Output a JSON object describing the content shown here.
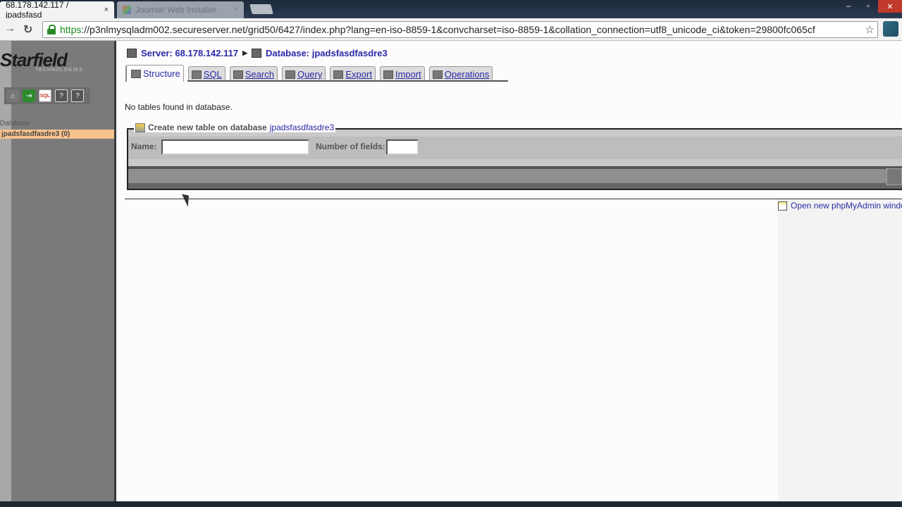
{
  "browser": {
    "tabs": [
      {
        "title": "68.178.142.117 / jpadsfasd",
        "active": true
      },
      {
        "title": "Joomla! Web Installer",
        "active": false
      }
    ],
    "url_scheme": "https",
    "url_rest": "://p3nlmysqladm002.secureserver.net/grid50/6427/index.php?lang=en-iso-8859-1&convcharset=iso-8859-1&collation_connection=utf8_unicode_ci&token=29800fc065cf",
    "close_glyph": "×",
    "back_glyph": "→",
    "reload_glyph": "↻",
    "star_glyph": "☆",
    "window_controls": {
      "minimize": "–",
      "maximize": "▫",
      "close": "✕"
    }
  },
  "sidebar": {
    "logo_text": "Starfield",
    "logo_subtitle": "TECHNOLOGIES",
    "icons": [
      {
        "name": "home",
        "glyph": "⌂"
      },
      {
        "name": "exit",
        "glyph": "⇥"
      },
      {
        "name": "sql",
        "glyph": "SQL"
      },
      {
        "name": "help",
        "glyph": "?"
      },
      {
        "name": "docs",
        "glyph": "?"
      }
    ],
    "db_label": "Database",
    "db_item": "jpadsfasdfasdre3 (0)"
  },
  "breadcrumb": {
    "server_label": "Server: 68.178.142.117",
    "separator": "▶",
    "database_label": "Database: jpadsfasdfasdre3"
  },
  "tabs": [
    {
      "label": "Structure",
      "active": true
    },
    {
      "label": "SQL",
      "active": false
    },
    {
      "label": "Search",
      "active": false
    },
    {
      "label": "Query",
      "active": false
    },
    {
      "label": "Export",
      "active": false
    },
    {
      "label": "Import",
      "active": false
    },
    {
      "label": "Operations",
      "active": false
    }
  ],
  "main": {
    "notice": "No tables found in database.",
    "create_table": {
      "legend_prefix": "Create new table on database",
      "legend_db": "jpadsfasdfasdre3",
      "name_label": "Name:",
      "name_value": "",
      "fields_label": "Number of fields:",
      "fields_value": ""
    },
    "open_new_window": "Open new phpMyAdmin window"
  }
}
